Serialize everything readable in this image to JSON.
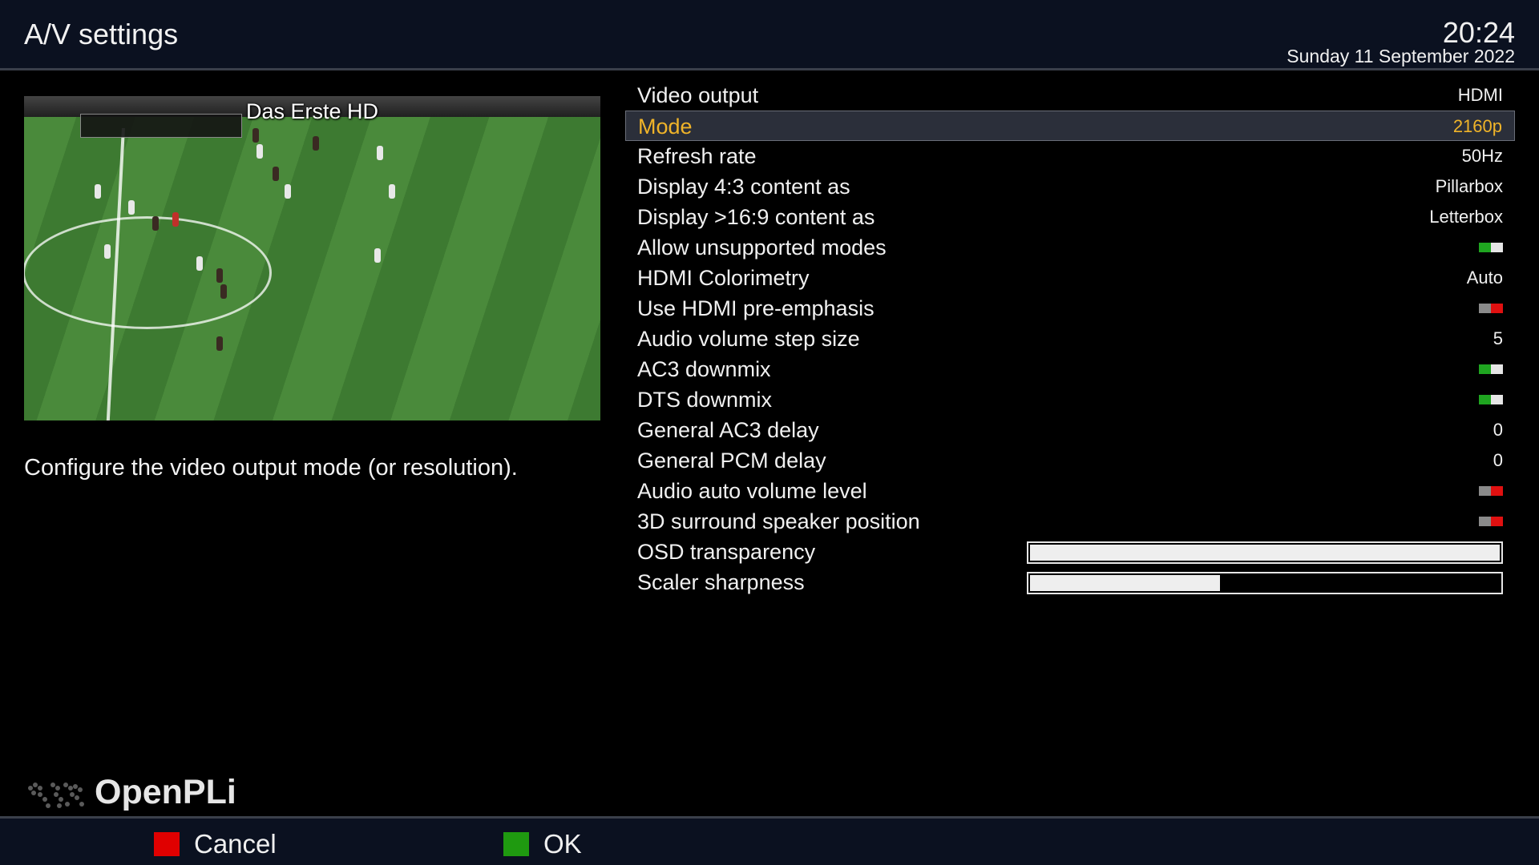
{
  "header": {
    "title": "A/V settings",
    "time": "20:24",
    "date": "Sunday 11 September 2022"
  },
  "preview": {
    "channel_name": "Das Erste HD"
  },
  "help_text": "Configure the video output mode (or resolution).",
  "settings": [
    {
      "label": "Video output",
      "type": "text",
      "value": "HDMI"
    },
    {
      "label": "Mode",
      "type": "text",
      "value": "2160p",
      "selected": true
    },
    {
      "label": "Refresh rate",
      "type": "text",
      "value": "50Hz"
    },
    {
      "label": "Display 4:3 content as",
      "type": "text",
      "value": "Pillarbox"
    },
    {
      "label": "Display >16:9 content as",
      "type": "text",
      "value": "Letterbox"
    },
    {
      "label": "Allow unsupported modes",
      "type": "toggle",
      "state": "on"
    },
    {
      "label": "HDMI Colorimetry",
      "type": "text",
      "value": "Auto"
    },
    {
      "label": "Use HDMI pre-emphasis",
      "type": "toggle",
      "state": "off"
    },
    {
      "label": "Audio volume step size",
      "type": "text",
      "value": "5"
    },
    {
      "label": "AC3 downmix",
      "type": "toggle",
      "state": "on"
    },
    {
      "label": "DTS downmix",
      "type": "toggle",
      "state": "on"
    },
    {
      "label": "General AC3 delay",
      "type": "text",
      "value": "0"
    },
    {
      "label": "General PCM delay",
      "type": "text",
      "value": "0"
    },
    {
      "label": "Audio auto volume level",
      "type": "toggle",
      "state": "off"
    },
    {
      "label": "3D surround speaker position",
      "type": "toggle",
      "state": "off"
    },
    {
      "label": "OSD transparency",
      "type": "slider",
      "level": 1.0
    },
    {
      "label": "Scaler sharpness",
      "type": "slider",
      "level": 0.405
    }
  ],
  "logo": {
    "text": "OpenPLi"
  },
  "footer": {
    "cancel_label": "Cancel",
    "ok_label": "OK",
    "colors": {
      "cancel": "#e00000",
      "ok": "#1f9a10",
      "selected_text": "#f0b429"
    }
  }
}
